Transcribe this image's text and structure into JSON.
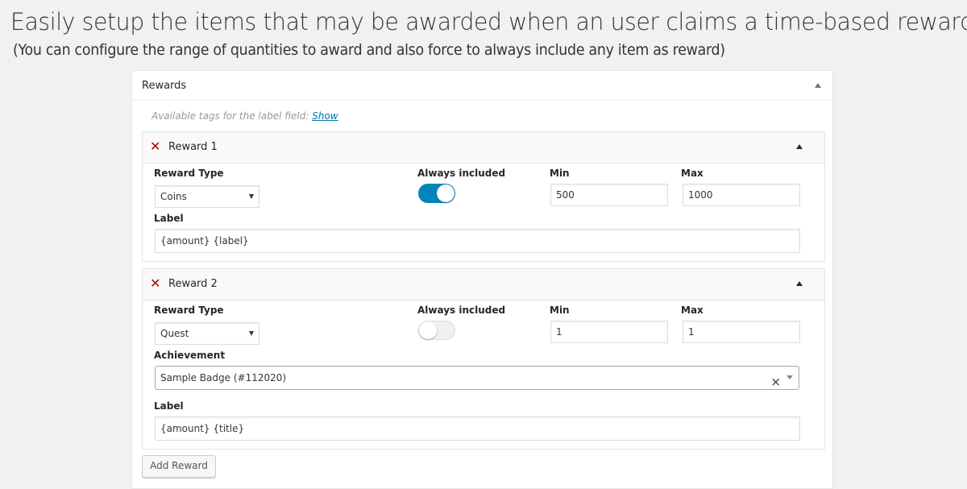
{
  "header": {
    "title": "Easily setup the items that may be awarded when an user claims a time-based reward",
    "subtitle": "(You can configure the range of quantities to award and also force to always include any item as reward)"
  },
  "panel": {
    "title": "Rewards",
    "tags_note": "Available tags for the label field:",
    "tags_link": "Show",
    "add_button": "Add Reward"
  },
  "labels": {
    "reward_type": "Reward Type",
    "always_included": "Always included",
    "min": "Min",
    "max": "Max",
    "label": "Label",
    "achievement": "Achievement"
  },
  "rewards": [
    {
      "name": "Reward 1",
      "type": "Coins",
      "always_included": true,
      "min": "500",
      "max": "1000",
      "label": "{amount} {label}"
    },
    {
      "name": "Reward 2",
      "type": "Quest",
      "always_included": false,
      "min": "1",
      "max": "1",
      "achievement": "Sample Badge (#112020)",
      "label": "{amount} {title}"
    }
  ],
  "colors": {
    "accent": "#0085ba",
    "remove": "#aa0000",
    "link": "#0073aa"
  }
}
